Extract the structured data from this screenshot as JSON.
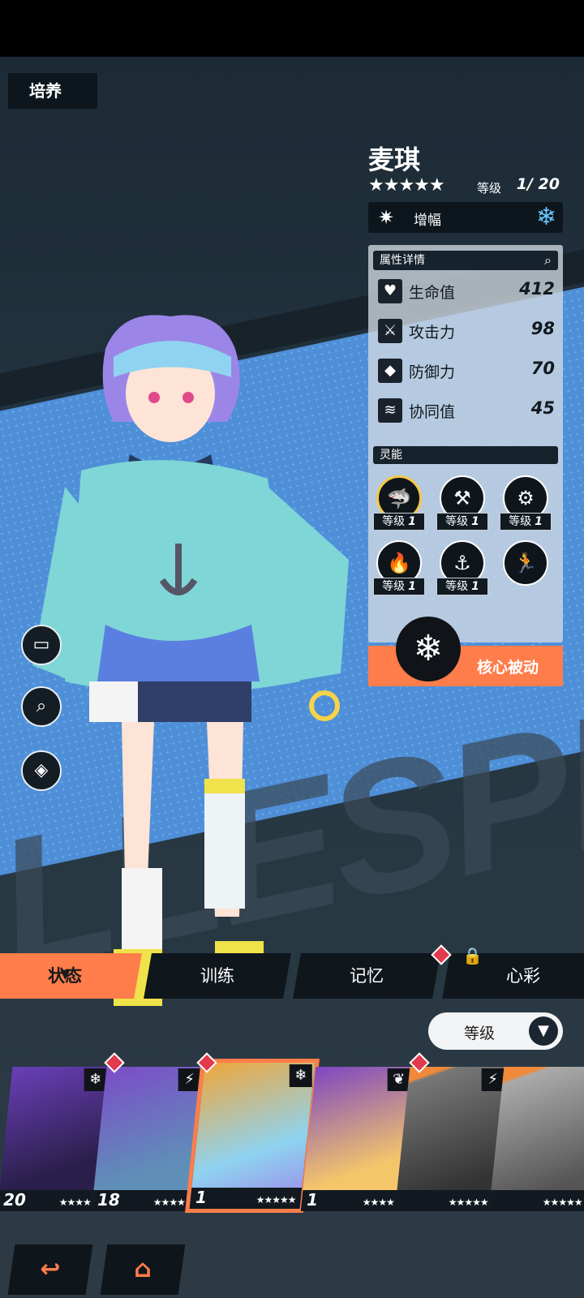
{
  "header": {
    "title": "培养"
  },
  "character": {
    "name": "麦琪",
    "stars": "★★★★★",
    "level_label": "等级",
    "level_value": "1/ 20",
    "role": "增幅",
    "element_icon": "snowflake-icon"
  },
  "stats": {
    "title": "属性详情",
    "items": [
      {
        "label": "生命值",
        "value": "412",
        "icon": "heart-pulse-icon"
      },
      {
        "label": "攻击力",
        "value": "98",
        "icon": "sword-icon"
      },
      {
        "label": "防御力",
        "value": "70",
        "icon": "shield-icon"
      },
      {
        "label": "协同值",
        "value": "45",
        "icon": "synergy-icon"
      }
    ]
  },
  "psi": {
    "title": "灵能",
    "skills": [
      {
        "tag": "等级",
        "level": "1",
        "icon": "shark-icon"
      },
      {
        "tag": "等级",
        "level": "1",
        "icon": "ice-hammer-icon"
      },
      {
        "tag": "等级",
        "level": "1",
        "icon": "gear-burst-icon"
      },
      {
        "tag": "等级",
        "level": "1",
        "icon": "flame-icon"
      },
      {
        "tag": "等级",
        "level": "1",
        "icon": "anchor-icon"
      },
      {
        "icon": "running-figure-icon"
      }
    ]
  },
  "core": {
    "label": "核心被动"
  },
  "tabs": [
    {
      "label": "状态",
      "active": true
    },
    {
      "label": "训练"
    },
    {
      "label": "记忆"
    },
    {
      "label": "心彩",
      "locked": true
    }
  ],
  "sort": {
    "label": "等级"
  },
  "roster": [
    {
      "level": "20",
      "stars": "★★★★",
      "element": "snowflake-icon",
      "color": "#6a3fb8"
    },
    {
      "level": "18",
      "stars": "★★★★",
      "element": "lightning-icon",
      "color": "#7c4cc8"
    },
    {
      "level": "1",
      "stars": "★★★★★",
      "element": "snowflake-icon",
      "color": "#f0a63a",
      "selected": true
    },
    {
      "level": "1",
      "stars": "★★★★",
      "element": "leaf-icon",
      "color": "#7d46c2"
    },
    {
      "level": "",
      "stars": "★★★★★",
      "element": "lightning-icon",
      "color": "#777"
    },
    {
      "level": "",
      "stars": "★★★★★",
      "element": "",
      "color": "#888"
    }
  ],
  "colors": {
    "accent": "#ff7d4a",
    "panel": "#d2dae2",
    "dark": "#0d161d"
  }
}
